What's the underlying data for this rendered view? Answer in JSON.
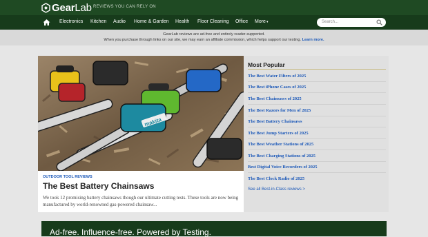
{
  "brand": {
    "logo_gear": "Gear",
    "logo_lab": "Lab",
    "tagline": "REVIEWS YOU CAN RELY ON",
    "colors": {
      "header": "#1f4a23",
      "nav": "#173b1b",
      "link": "#1a57b8"
    }
  },
  "nav": {
    "home_icon": "home-icon",
    "items": [
      "Electronics",
      "Kitchen",
      "Audio",
      "Home & Garden",
      "Health",
      "Floor Cleaning",
      "Office",
      "More"
    ],
    "search_placeholder": "Search..."
  },
  "notice": {
    "line1": "GearLab reviews are ad-free and entirely reader-supported.",
    "line2": "When you purchase through links on our site, we may earn an affiliate commission, which helps support our testing.",
    "learn_more": "Learn more."
  },
  "featured": {
    "kicker": "OUTDOOR TOOL REVIEWS",
    "title": "The Best Battery Chainsaws",
    "teaser": "We took 12 promising battery chainsaws though our ultimate cutting tests. These tools are now being manufactured by world-renowned gas-powered chainsaw...",
    "image_brand": "makita"
  },
  "popular": {
    "title": "Most Popular",
    "items": [
      "The Best Water Filters of 2025",
      "The Best iPhone Cases of 2025",
      "The Best Chainsaws of 2025",
      "The Best Razors for Men of 2025",
      "The Best Battery Chainsaws",
      "The Best Jump Starters of 2025",
      "The Best Weather Stations of 2025",
      "The Best Charging Stations of 2025",
      "Best Digital Voice Recorders of 2025",
      "The Best Clock Radio of 2025"
    ],
    "see_all": "See all Best-in-Class reviews >"
  },
  "banner": {
    "text": "Ad-free. Influence-free. Powered by Testing."
  }
}
